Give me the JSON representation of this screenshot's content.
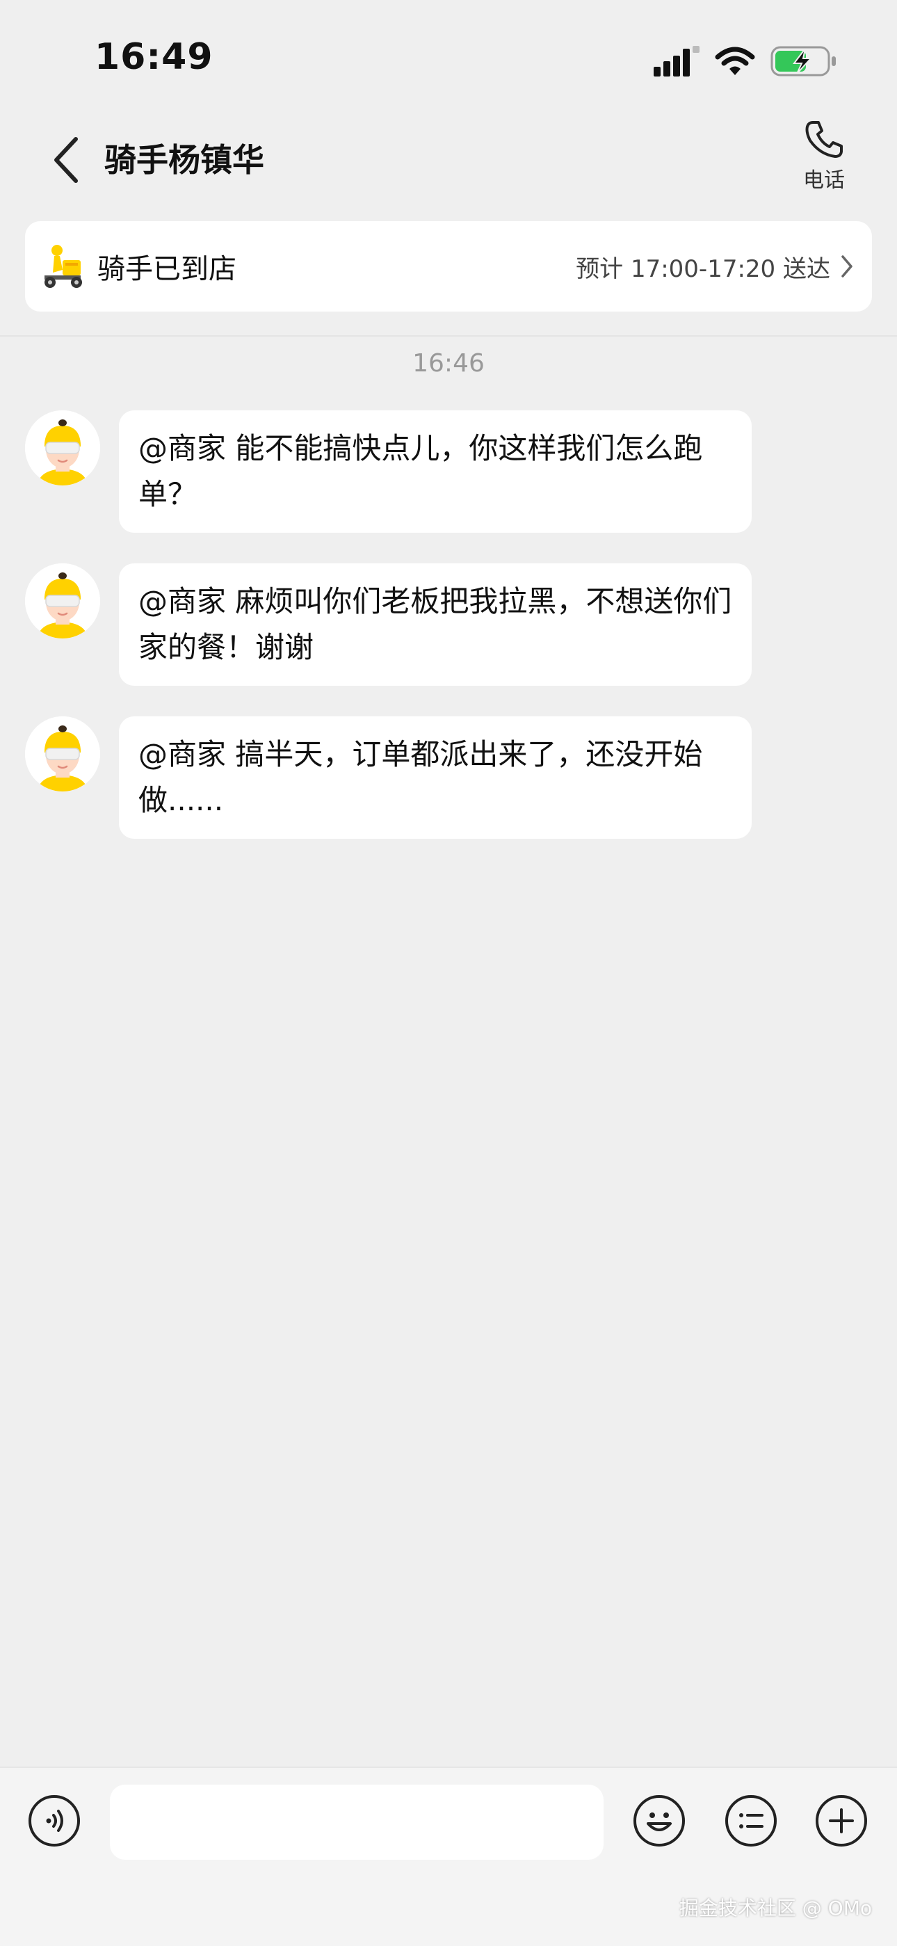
{
  "status_bar": {
    "time": "16:49"
  },
  "header": {
    "title": "骑手杨镇华",
    "phone_label": "电话"
  },
  "delivery": {
    "status": "骑手已到店",
    "eta": "预计 17:00-17:20 送达"
  },
  "chat": {
    "timestamp": "16:46",
    "messages": [
      {
        "text": "@商家  能不能搞快点儿，你这样我们怎么跑单？"
      },
      {
        "text": "@商家  麻烦叫你们老板把我拉黑，不想送你们家的餐！谢谢"
      },
      {
        "text": "@商家  搞半天，订单都派出来了，还没开始做......"
      }
    ]
  },
  "input": {
    "placeholder": ""
  },
  "watermark": "掘金技术社区 @ OMo",
  "colors": {
    "accent_yellow": "#ffd100",
    "background": "#efefef",
    "battery_green": "#34c759"
  }
}
